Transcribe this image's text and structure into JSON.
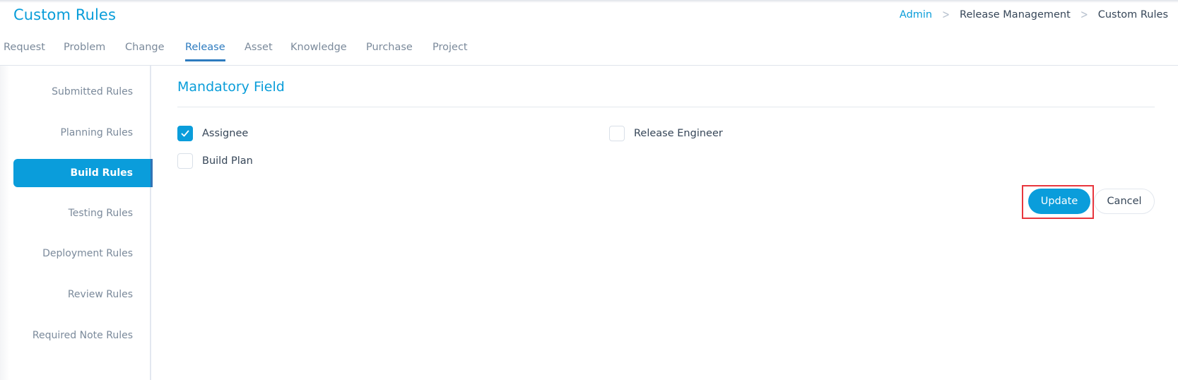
{
  "header": {
    "title": "Custom Rules",
    "breadcrumb": [
      "Admin",
      "Release Management",
      "Custom Rules"
    ]
  },
  "tabs": [
    {
      "label": "Request",
      "active": false
    },
    {
      "label": "Problem",
      "active": false
    },
    {
      "label": "Change",
      "active": false
    },
    {
      "label": "Release",
      "active": true
    },
    {
      "label": "Asset",
      "active": false
    },
    {
      "label": "Knowledge",
      "active": false
    },
    {
      "label": "Purchase",
      "active": false
    },
    {
      "label": "Project",
      "active": false
    }
  ],
  "sidebar": {
    "items": [
      {
        "label": "Submitted Rules",
        "active": false
      },
      {
        "label": "Planning Rules",
        "active": false
      },
      {
        "label": "Build Rules",
        "active": true
      },
      {
        "label": "Testing Rules",
        "active": false
      },
      {
        "label": "Deployment Rules",
        "active": false
      },
      {
        "label": "Review Rules",
        "active": false
      },
      {
        "label": "Required Note Rules",
        "active": false
      }
    ]
  },
  "main": {
    "section_title": "Mandatory Field",
    "fields": [
      {
        "label": "Assignee",
        "checked": true
      },
      {
        "label": "Release Engineer",
        "checked": false
      },
      {
        "label": "Build Plan",
        "checked": false
      }
    ],
    "update_label": "Update",
    "cancel_label": "Cancel"
  },
  "colors": {
    "accent": "#0a9ddb",
    "active_tab": "#2d7bbf",
    "highlight_border": "#e8363d"
  }
}
